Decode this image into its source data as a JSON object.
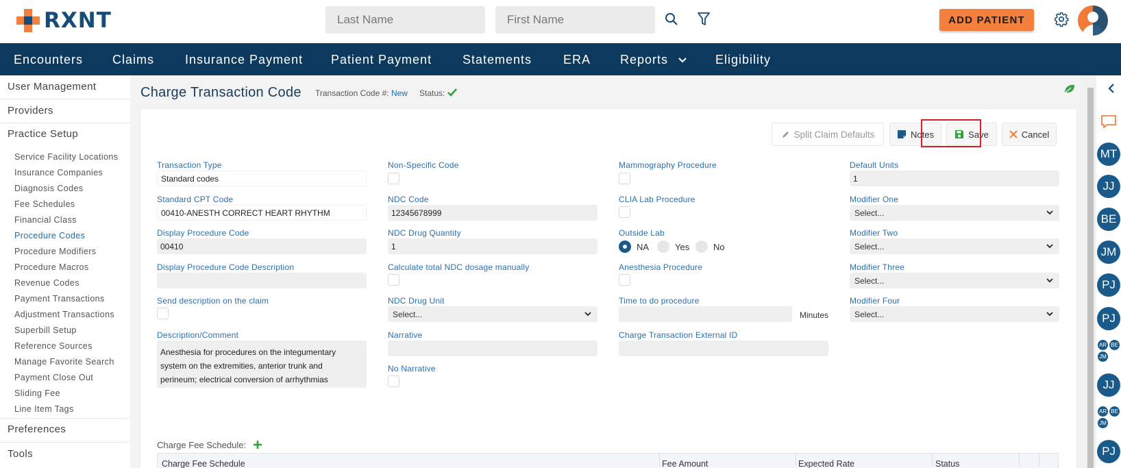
{
  "app": {
    "logo_text": "RXNT",
    "brand_color": "#154c79",
    "accent_color": "#f5803e"
  },
  "header": {
    "last_name_placeholder": "Last Name",
    "first_name_placeholder": "First Name",
    "add_patient_label": "ADD PATIENT"
  },
  "nav": {
    "items": [
      "Encounters",
      "Claims",
      "Insurance Payment",
      "Patient Payment",
      "Statements",
      "ERA",
      "Reports",
      "Eligibility"
    ]
  },
  "sidebar": {
    "sections": [
      "User Management",
      "Providers",
      "Practice Setup",
      "Preferences",
      "Tools"
    ],
    "practice_items": [
      "Service Facility Locations",
      "Insurance Companies",
      "Diagnosis Codes",
      "Fee Schedules",
      "Financial Class",
      "Procedure Codes",
      "Procedure Modifiers",
      "Procedure Macros",
      "Revenue Codes",
      "Payment Transactions",
      "Adjustment Transactions",
      "Superbill Setup",
      "Reference Sources",
      "Manage Favorite Search",
      "Payment Close Out",
      "Sliding Fee",
      "Line Item Tags"
    ],
    "active_item": "Procedure Codes"
  },
  "page": {
    "title": "Charge Transaction Code",
    "transaction_code_label": "Transaction Code #:",
    "transaction_code_value": "New",
    "status_label": "Status:"
  },
  "toolbar": {
    "split_label": "Split Claim Defaults",
    "notes_label": "Notes",
    "save_label": "Save",
    "cancel_label": "Cancel"
  },
  "form": {
    "transaction_type_label": "Transaction Type",
    "transaction_type_value": "Standard codes",
    "standard_cpt_label": "Standard CPT Code",
    "standard_cpt_value": "00410-ANESTH CORRECT HEART RHYTHM",
    "display_code_label": "Display Procedure Code",
    "display_code_value": "00410",
    "display_desc_label": "Display Procedure Code Description",
    "display_desc_value": "",
    "send_desc_label": "Send description on the claim",
    "desc_comment_label": "Description/Comment",
    "desc_comment_lines": [
      "Anesthesia for procedures on the integumentary",
      "system on the extremities, anterior trunk and",
      "perineum; electrical conversion of arrhythmias"
    ],
    "non_specific_label": "Non-Specific Code",
    "ndc_code_label": "NDC Code",
    "ndc_code_value": "12345678999",
    "ndc_qty_label": "NDC Drug Quantity",
    "ndc_qty_value": "1",
    "calc_ndc_label": "Calculate total NDC dosage manually",
    "ndc_unit_label": "NDC Drug Unit",
    "ndc_unit_value": "Select...",
    "narrative_label": "Narrative",
    "narrative_value": "",
    "no_narrative_label": "No Narrative",
    "mammo_label": "Mammography Procedure",
    "clia_label": "CLIA Lab Procedure",
    "outside_lab_label": "Outside Lab",
    "outside_lab_options": [
      "NA",
      "Yes",
      "No"
    ],
    "outside_lab_selected": "NA",
    "anesthesia_label": "Anesthesia Procedure",
    "time_label": "Time to do procedure",
    "time_value": "",
    "minutes_label": "Minutes",
    "external_id_label": "Charge Transaction External ID",
    "external_id_value": "",
    "default_units_label": "Default Units",
    "default_units_value": "1",
    "mod1_label": "Modifier One",
    "mod2_label": "Modifier Two",
    "mod3_label": "Modifier Three",
    "mod4_label": "Modifier Four",
    "select_placeholder": "Select..."
  },
  "fee_schedule": {
    "label": "Charge Fee Schedule:",
    "columns": [
      "Charge Fee Schedule",
      "Fee Amount",
      "Expected Rate",
      "Status"
    ]
  },
  "rail": {
    "big_bubbles": [
      "MT",
      "JJ",
      "BE",
      "JM",
      "PJ",
      "PJ"
    ],
    "small_group_1": [
      "AR",
      "BE",
      "JM"
    ],
    "big_after_group_1": "JJ",
    "small_group_2": [
      "AR",
      "BE",
      "JM"
    ],
    "big_after_group_2": "PJ"
  }
}
